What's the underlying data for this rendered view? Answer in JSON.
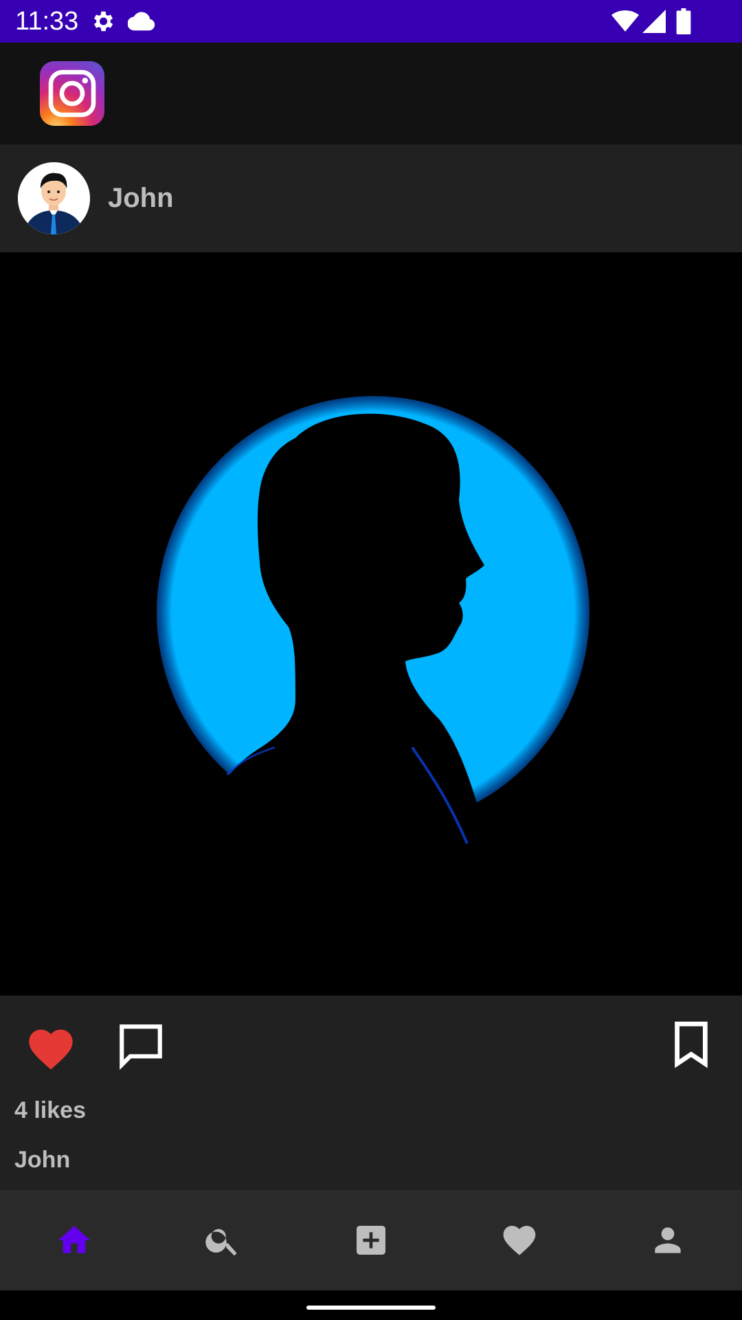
{
  "status": {
    "time": "11:33",
    "icons": [
      "settings-icon",
      "cloud-icon",
      "wifi-icon",
      "signal-icon",
      "battery-icon"
    ]
  },
  "app": {
    "logo": "instagram-logo"
  },
  "post": {
    "author": "John",
    "likes": "4 likes",
    "caption_author": "John",
    "liked": true
  },
  "nav": {
    "items": [
      {
        "icon": "home-icon",
        "active": true
      },
      {
        "icon": "search-icon",
        "active": false
      },
      {
        "icon": "add-box-icon",
        "active": false
      },
      {
        "icon": "heart-icon",
        "active": false
      },
      {
        "icon": "person-icon",
        "active": false
      }
    ]
  },
  "colors": {
    "status_bar": "#3700B3",
    "active_nav": "#6200EE",
    "like_red": "#E53935",
    "image_glow": "#00B4FF"
  }
}
